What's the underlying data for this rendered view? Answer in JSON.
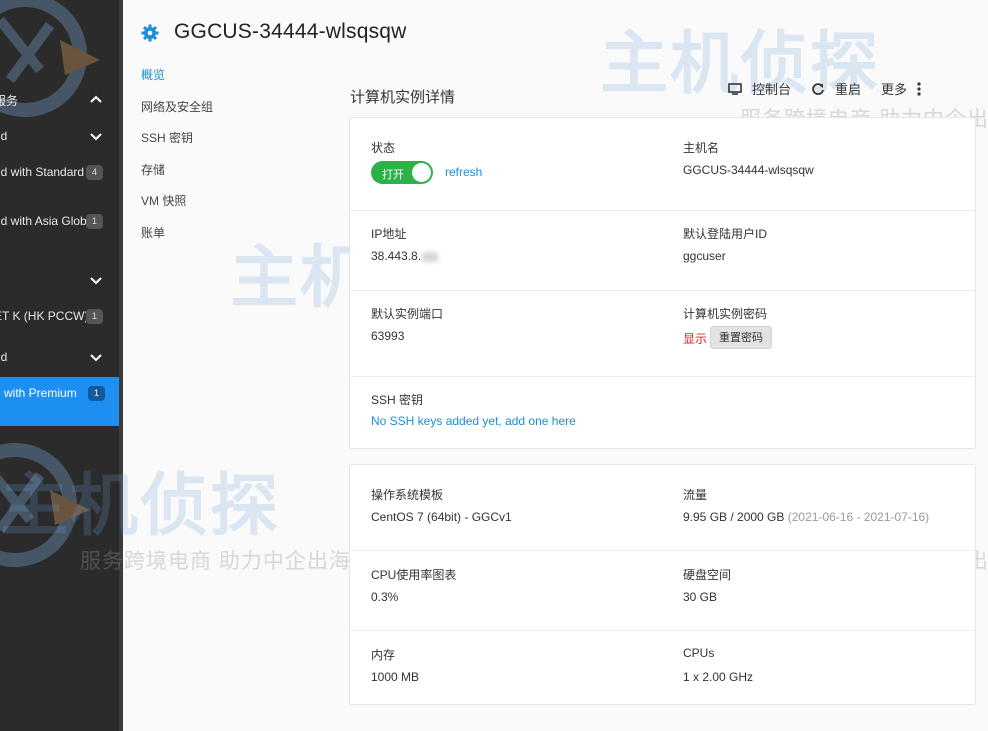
{
  "sidebar": {
    "items": [
      {
        "label": "服务",
        "badge": "",
        "chevron": "chevron-up"
      },
      {
        "label": "ud",
        "badge": "",
        "chevron": "chevron-down"
      },
      {
        "label": "ud with Standard",
        "badge": "4",
        "chevron": ""
      },
      {
        "label": "ud with Asia Globa",
        "badge": "1",
        "chevron": ""
      },
      {
        "label": "",
        "badge": "",
        "chevron": "chevron-down"
      },
      {
        "label": "ET K (HK PCCW)",
        "badge": "1",
        "chevron": ""
      },
      {
        "label": "ud",
        "badge": "",
        "chevron": "chevron-down"
      },
      {
        "label": "d with Premium",
        "badge": "1",
        "chevron": ""
      }
    ]
  },
  "header": {
    "title": "GGCUS-34444-wlsqsqw",
    "icon": "gear-icon"
  },
  "subnav": {
    "items": [
      "概览",
      "网络及安全组",
      "SSH 密钥",
      "存储",
      "VM 快照",
      "账单"
    ]
  },
  "section": {
    "title": "计算机实例详情"
  },
  "toolbar": {
    "console": "控制台",
    "restart": "重启",
    "more": "更多"
  },
  "details": {
    "status_label": "状态",
    "status_toggle": "打开",
    "refresh": "refresh",
    "hostname_label": "主机名",
    "hostname": "GGCUS-34444-wlsqsqw",
    "ip_label": "IP地址",
    "ip": "38.443.8.",
    "user_label": "默认登陆用户ID",
    "user": "ggcuser",
    "port_label": "默认实例端口",
    "port": "63993",
    "password_label": "计算机实例密码",
    "password_show": "显示",
    "password_reset": "重置密码",
    "ssh_label": "SSH 密钥",
    "ssh_link": "No SSH keys added yet, add one here"
  },
  "specs": {
    "os_label": "操作系统模板",
    "os": "CentOS 7 (64bit) - GGCv1",
    "traffic_label": "流量",
    "traffic": "9.95 GB / 2000 GB",
    "traffic_range": "(2021-06-16 - 2021-07-16)",
    "cpu_chart_label": "CPU使用率图表",
    "cpu_usage": "0.3%",
    "disk_label": "硬盘空间",
    "disk": "30 GB",
    "memory_label": "内存",
    "memory": "1000 MB",
    "cpus_label": "CPUs",
    "cpus": "1 x 2.00 GHz"
  },
  "watermark": {
    "main": "主机侦探",
    "sub": "服务跨境电商 助力中企出海"
  },
  "colors": {
    "accent": "#1a8fd6",
    "sidebar_bg": "#2b2b2b",
    "sidebar_active": "#1c8ff0",
    "toggle_on": "#2db24a",
    "danger": "#e02020"
  }
}
